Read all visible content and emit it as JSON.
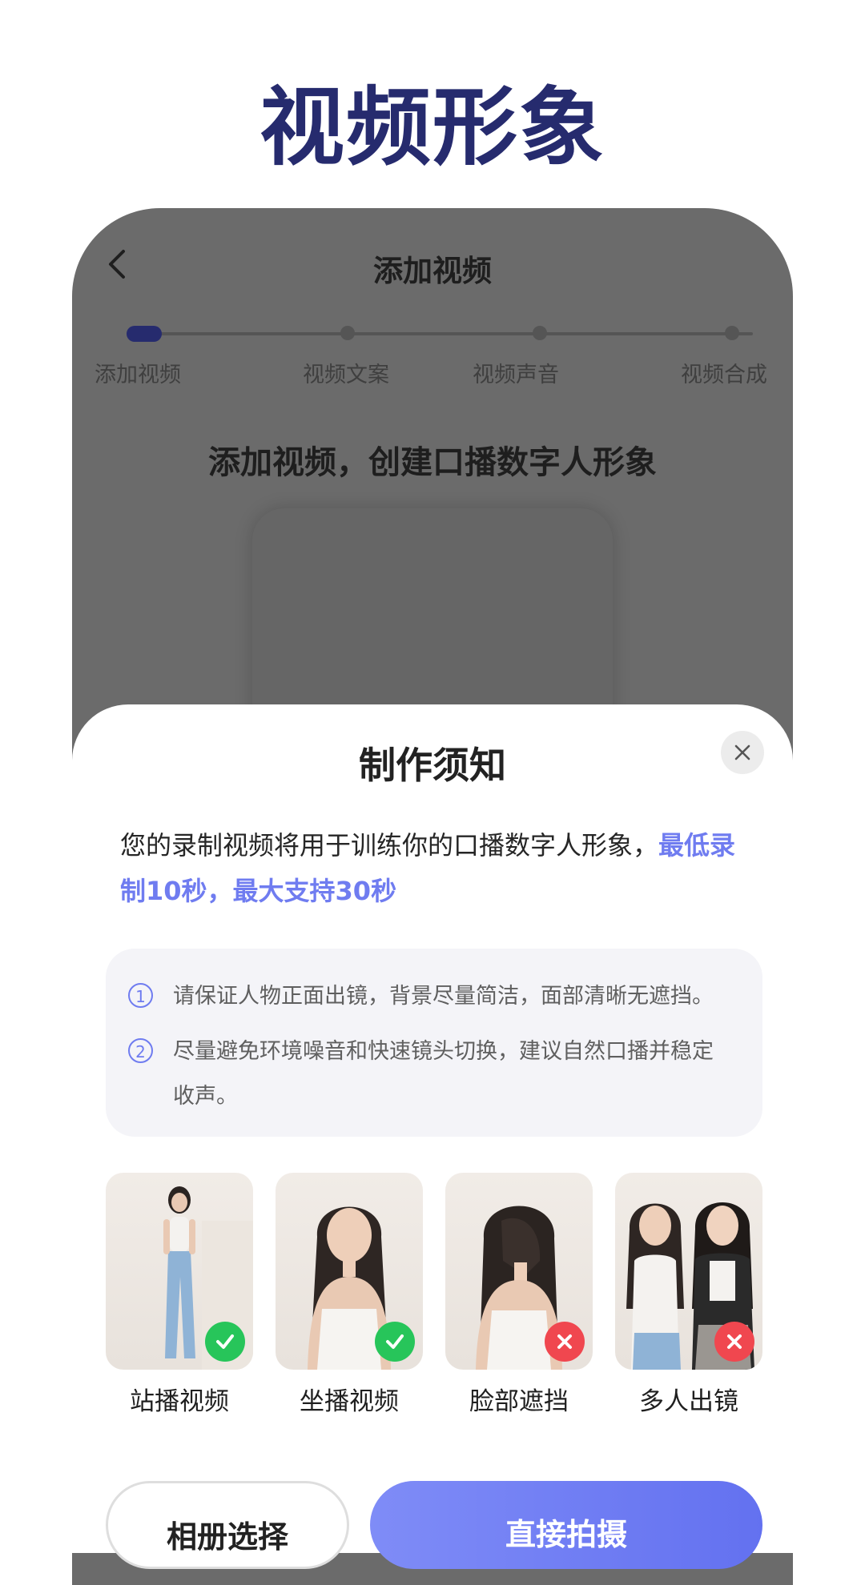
{
  "headline": "视频形象",
  "app": {
    "nav_title": "添加视频",
    "steps": [
      "添加视频",
      "视频文案",
      "视频声音",
      "视频合成"
    ],
    "active_step": 0,
    "heading": "添加视频，创建口播数字人形象"
  },
  "sheet": {
    "title": "制作须知",
    "intro_text": "您的录制视频将用于训练你的口播数字人形象，",
    "intro_highlight": "最低录制10秒，最大支持30秒",
    "tips": [
      {
        "num": "1",
        "text": "请保证人物正面出镜，背景尽量简洁，面部清晰无遮挡。"
      },
      {
        "num": "2",
        "text": "尽量避免环境噪音和快速镜头切换，建议自然口播并稳定收声。"
      }
    ],
    "examples": [
      {
        "label": "站播视频",
        "status": "correct"
      },
      {
        "label": "坐播视频",
        "status": "correct"
      },
      {
        "label": "脸部遮挡",
        "status": "wrong"
      },
      {
        "label": "多人出镜",
        "status": "wrong"
      }
    ],
    "album_button": "相册选择",
    "shoot_button": "直接拍摄"
  },
  "colors": {
    "headline": "#262b6e",
    "accent": "#6f7cf0",
    "correct": "#27c55a",
    "wrong": "#f0474f",
    "overlay": "#6b6b6b"
  }
}
